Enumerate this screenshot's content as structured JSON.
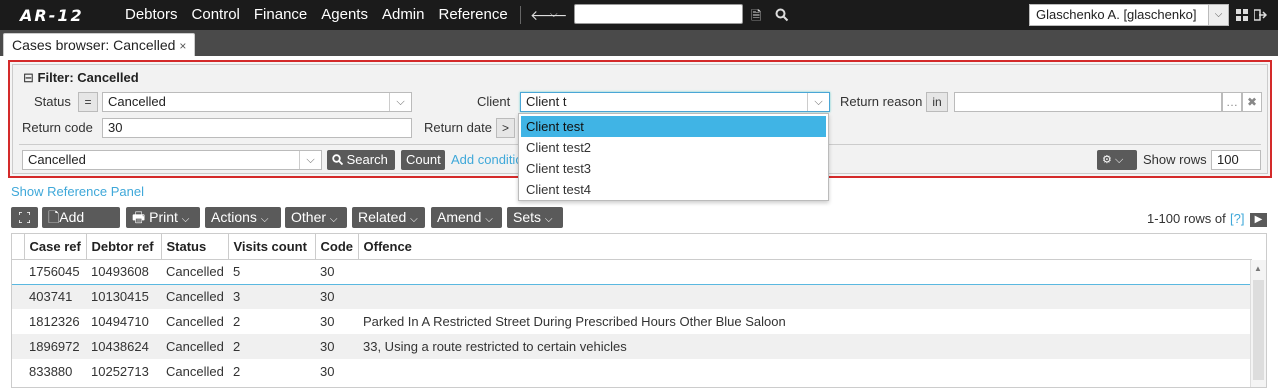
{
  "app": {
    "logo": "AR-12"
  },
  "menu": [
    "Debtors",
    "Control",
    "Finance",
    "Agents",
    "Admin",
    "Reference"
  ],
  "user": {
    "name": "Glaschenko A. [glaschenko]"
  },
  "tab": {
    "label": "Cases browser: Cancelled",
    "close": "×"
  },
  "filter": {
    "title": "Filter: Cancelled",
    "status_label": "Status",
    "status_op": "=",
    "status_value": "Cancelled",
    "client_label": "Client",
    "client_value": "Client t",
    "return_reason_label": "Return reason",
    "return_reason_op": "in",
    "return_code_label": "Return code",
    "return_code_value": "30",
    "return_date_label": "Return date",
    "return_date_op": ">",
    "saved_filter_value": "Cancelled",
    "search_btn": "Search",
    "count_btn": "Count",
    "add_condition": "Add conditio",
    "show_rows_label": "Show rows",
    "show_rows_value": "100"
  },
  "client_options": [
    "Client test",
    "Client test2",
    "Client test3",
    "Client test4"
  ],
  "show_reference_panel": "Show Reference Panel",
  "toolbar": {
    "add_note": "Add note",
    "print": "Print",
    "actions": "Actions",
    "other": "Other",
    "related": "Related",
    "amend": "Amend",
    "sets": "Sets",
    "rows_info": "1-100 rows of",
    "rows_help": "[?]"
  },
  "table": {
    "columns": [
      "Case ref",
      "Debtor ref",
      "Status",
      "Visits count",
      "Code",
      "Offence"
    ],
    "rows": [
      [
        "1756045",
        "10493608",
        "Cancelled",
        "5",
        "30",
        ""
      ],
      [
        "403741",
        "10130415",
        "Cancelled",
        "3",
        "30",
        ""
      ],
      [
        "1812326",
        "10494710",
        "Cancelled",
        "2",
        "30",
        "Parked In A Restricted Street During Prescribed Hours Other Blue Saloon"
      ],
      [
        "1896972",
        "10438624",
        "Cancelled",
        "2",
        "30",
        "33, Using a route restricted to certain vehicles"
      ],
      [
        "833880",
        "10252713",
        "Cancelled",
        "2",
        "30",
        ""
      ]
    ]
  }
}
